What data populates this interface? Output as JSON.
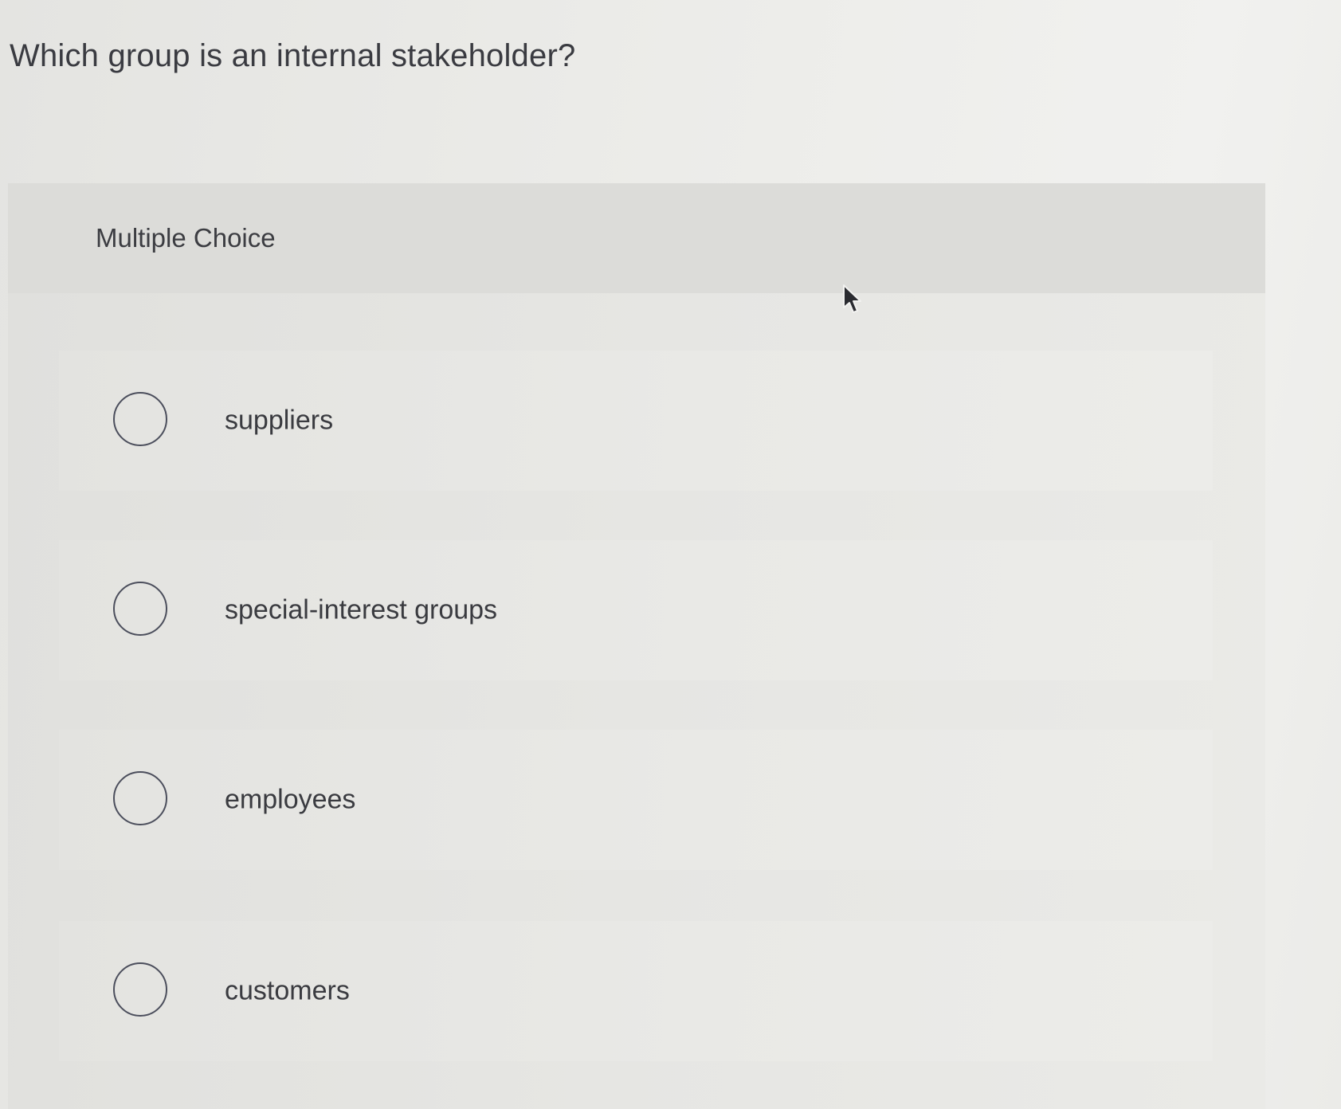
{
  "question": {
    "text": "Which group is an internal stakeholder?"
  },
  "card": {
    "type_label": "Multiple Choice"
  },
  "options": [
    {
      "label": "suppliers",
      "selected": false
    },
    {
      "label": "special-interest groups",
      "selected": false
    },
    {
      "label": "employees",
      "selected": false
    },
    {
      "label": "customers",
      "selected": false
    }
  ],
  "icons": {
    "radio": "radio-unselected-icon",
    "cursor": "mouse-pointer-icon"
  },
  "colors": {
    "text": "#3a3b40",
    "radio_border": "#4b4e5c",
    "background": "#ececea"
  }
}
